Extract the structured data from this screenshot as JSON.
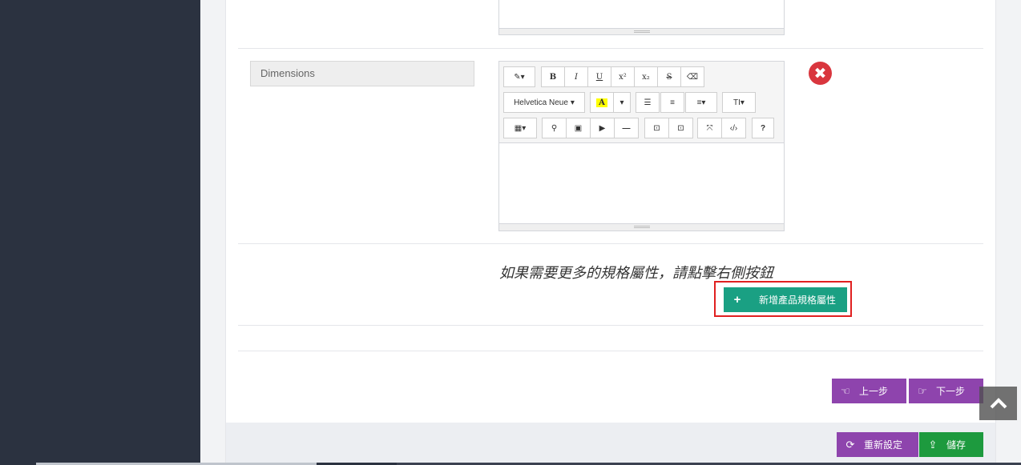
{
  "attribute": {
    "label": "Dimensions"
  },
  "toolbar": {
    "row1": [
      "✎▾",
      "B",
      "I",
      "U",
      "x²",
      "x₂",
      "S",
      "⌫"
    ],
    "font_name": "Helvetica Neue",
    "color_letter": "A",
    "row2_extra": [
      "☰",
      "≡",
      "≡▾",
      "TI▾"
    ],
    "row3": [
      "▦▾",
      "⚲",
      "▣",
      "▶",
      "—",
      "⊡",
      "⊡",
      "⤧",
      "‹/›",
      "?"
    ]
  },
  "hint_text": "如果需要更多的規格屬性，請點擊右側按鈕",
  "add_button": {
    "label": "新增產品規格屬性",
    "icon": "plus-icon"
  },
  "nav": {
    "prev_label": "上一步",
    "next_label": "下一步"
  },
  "footer": {
    "reset_label": "重新設定",
    "save_label": "儲存"
  },
  "colors": {
    "sidebar": "#2b3240",
    "add_button": "#1aa083",
    "nav_buttons": "#8e44ad",
    "save_button": "#1d9a3e",
    "remove": "#d9363e",
    "highlight": "#e02020"
  }
}
